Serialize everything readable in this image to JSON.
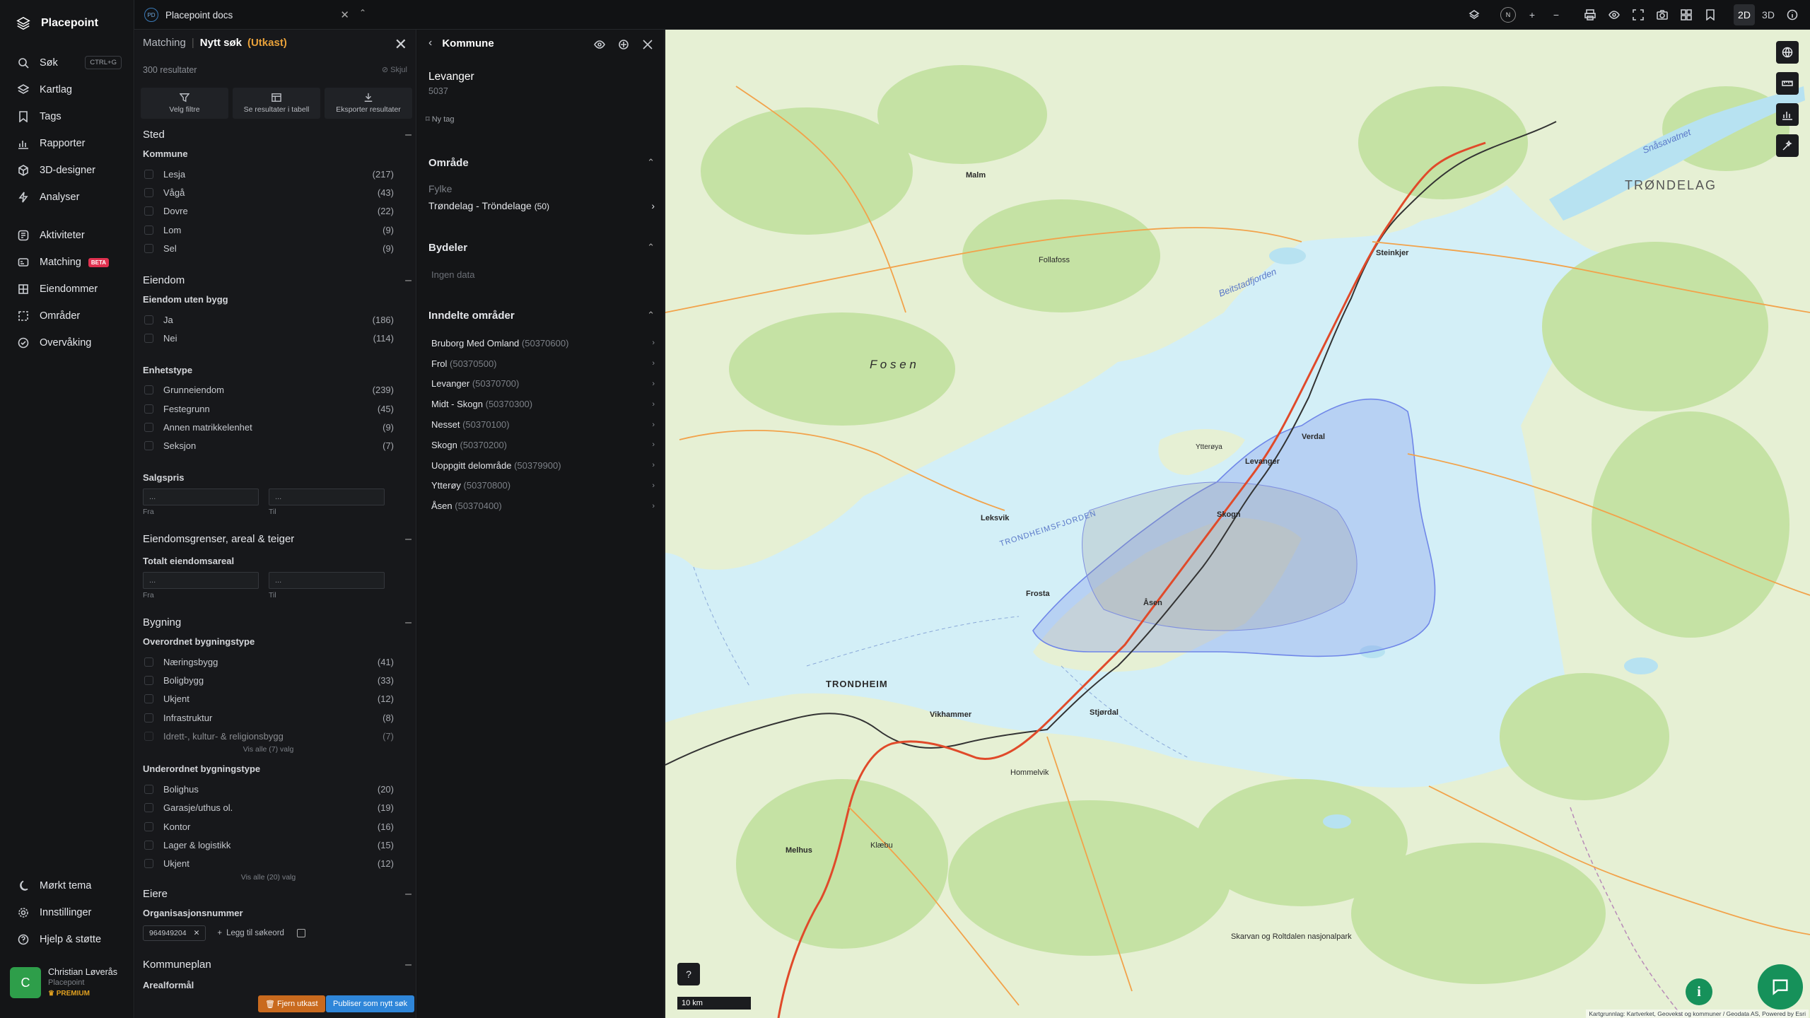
{
  "brand": {
    "name": "Placepoint"
  },
  "nav": {
    "items": [
      {
        "label": "Søk",
        "shortcut": "CTRL+G"
      },
      {
        "label": "Kartlag"
      },
      {
        "label": "Tags"
      },
      {
        "label": "Rapporter"
      },
      {
        "label": "3D-designer"
      },
      {
        "label": "Analyser"
      },
      {
        "label": "Aktiviteter"
      },
      {
        "label": "Matching",
        "badge": "BETA"
      },
      {
        "label": "Eiendommer"
      },
      {
        "label": "Områder"
      },
      {
        "label": "Overvåking"
      }
    ],
    "bottom": [
      {
        "label": "Mørkt tema"
      },
      {
        "label": "Innstillinger"
      },
      {
        "label": "Hjelp & støtte"
      }
    ]
  },
  "user": {
    "initial": "C",
    "name": "Christian Løverås",
    "org": "Placepoint",
    "plan": "PREMIUM"
  },
  "workspace": {
    "badge": "PD",
    "name": "Placepoint docs"
  },
  "topbar": {
    "mode_2d": "2D",
    "mode_3d": "3D",
    "compass": "N"
  },
  "matching": {
    "crumb": "Matching",
    "title": "Nytt søk",
    "status": "(Utkast)",
    "results": "300 resultater",
    "hide": "Skjul",
    "actions": {
      "filter": "Velg filtre",
      "table": "Se resultater i tabell",
      "export": "Eksporter resultater"
    },
    "sted": {
      "title": "Sted",
      "kommune_label": "Kommune",
      "kommune": [
        {
          "label": "Lesja",
          "count": "(217)"
        },
        {
          "label": "Vågå",
          "count": "(43)"
        },
        {
          "label": "Dovre",
          "count": "(22)"
        },
        {
          "label": "Lom",
          "count": "(9)"
        },
        {
          "label": "Sel",
          "count": "(9)"
        }
      ]
    },
    "eiendom": {
      "title": "Eiendom",
      "uten_bygg_label": "Eiendom uten bygg",
      "uten_bygg": [
        {
          "label": "Ja",
          "count": "(186)"
        },
        {
          "label": "Nei",
          "count": "(114)"
        }
      ],
      "enhetstype_label": "Enhetstype",
      "enhetstype": [
        {
          "label": "Grunneiendom",
          "count": "(239)"
        },
        {
          "label": "Festegrunn",
          "count": "(45)"
        },
        {
          "label": "Annen matrikkelenhet",
          "count": "(9)"
        },
        {
          "label": "Seksjon",
          "count": "(7)"
        }
      ],
      "salgspris_label": "Salgspris",
      "from_label": "Fra",
      "to_label": "Til",
      "range_placeholder": "..."
    },
    "grenser": {
      "title": "Eiendomsgrenser, areal & teiger",
      "areal_label": "Totalt eiendomsareal",
      "from_label": "Fra",
      "to_label": "Til",
      "range_placeholder": "..."
    },
    "bygning": {
      "title": "Bygning",
      "overordnet_label": "Overordnet bygningstype",
      "overordnet": [
        {
          "label": "Næringsbygg",
          "count": "(41)"
        },
        {
          "label": "Boligbygg",
          "count": "(33)"
        },
        {
          "label": "Ukjent",
          "count": "(12)"
        },
        {
          "label": "Infrastruktur",
          "count": "(8)"
        },
        {
          "label": "Idrett-, kultur- & religionsbygg",
          "count": "(7)"
        }
      ],
      "overordnet_showall": "Vis alle (7) valg",
      "underordnet_label": "Underordnet bygningstype",
      "underordnet": [
        {
          "label": "Bolighus",
          "count": "(20)"
        },
        {
          "label": "Garasje/uthus ol.",
          "count": "(19)"
        },
        {
          "label": "Kontor",
          "count": "(16)"
        },
        {
          "label": "Lager & logistikk",
          "count": "(15)"
        },
        {
          "label": "Ukjent",
          "count": "(12)"
        }
      ],
      "underordnet_showall": "Vis alle (20) valg"
    },
    "eiere": {
      "title": "Eiere",
      "org_label": "Organisasjonsnummer",
      "org_value": "964949204",
      "add_keyword": "Legg til søkeord"
    },
    "kommuneplan": {
      "title": "Kommuneplan",
      "arealformaal": "Arealformål"
    },
    "remove_draft": "Fjern utkast",
    "publish": "Publiser som nytt søk"
  },
  "kommune": {
    "title": "Kommune",
    "name": "Levanger",
    "number": "5037",
    "new_tag": "Ny tag",
    "omraade": {
      "title": "Område",
      "fylke_label": "Fylke",
      "fylke_value": "Trøndelag - Tröndelage",
      "fylke_count": "(50)"
    },
    "bydeler": {
      "title": "Bydeler",
      "empty": "Ingen data"
    },
    "inndelte": {
      "title": "Inndelte områder",
      "items": [
        {
          "name": "Bruborg Med Omland",
          "code": "(50370600)"
        },
        {
          "name": "Frol",
          "code": "(50370500)"
        },
        {
          "name": "Levanger",
          "code": "(50370700)"
        },
        {
          "name": "Midt - Skogn",
          "code": "(50370300)"
        },
        {
          "name": "Nesset",
          "code": "(50370100)"
        },
        {
          "name": "Skogn",
          "code": "(50370200)"
        },
        {
          "name": "Uoppgitt delområde",
          "code": "(50379900)"
        },
        {
          "name": "Ytterøy",
          "code": "(50370800)"
        },
        {
          "name": "Åsen",
          "code": "(50370400)"
        }
      ]
    }
  },
  "map": {
    "scale": "10 km",
    "attribution": "Kartgrunnlag: Kartverket, Geovekst og kommuner / Geodata AS, Powered by Esri",
    "labels": {
      "trondheim": "TRONDHEIM",
      "trondelag": "TRØNDELAG",
      "fosen": "F o s e n",
      "trondheimsfjorden": "TRONDHEIMSFJORDEN",
      "beitstadfjorden": "Beitstadfjorden",
      "snasavatnet": "Snåsavatnet",
      "steinkjer": "Steinkjer",
      "levanger": "Levanger",
      "verdal": "Verdal",
      "skogn": "Skogn",
      "ytteroya": "Ytterøya",
      "leksvik": "Leksvik",
      "stjordal": "Stjørdal",
      "malvik": "Vikhammer",
      "hommelvik": "Hommelvik",
      "frosta": "Frosta",
      "asen": "Åsen",
      "skarvan": "Skarvan og Roltdalen nasjonalpark",
      "malm": "Malm",
      "follafoss": "Follafoss",
      "klaebu": "Klæbu",
      "melhus": "Melhus"
    },
    "colors": {
      "water": "#d3eff7",
      "land": "#e9f2d8",
      "forest": "#c7e2a6",
      "selection": "#6f86e8"
    }
  }
}
